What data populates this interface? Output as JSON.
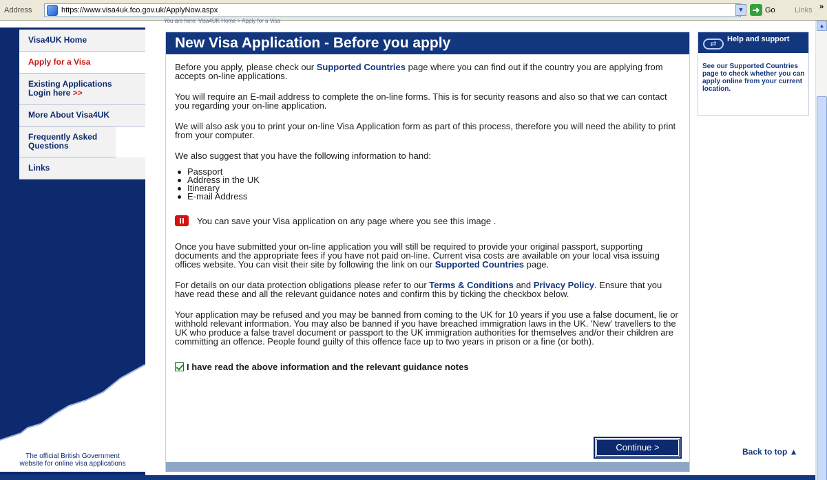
{
  "browser": {
    "address_label": "Address",
    "url": "https://www.visa4uk.fco.gov.uk/ApplyNow.aspx",
    "go_label": "Go",
    "links_label": "Links",
    "links_chevron": "»"
  },
  "breadcrumb": "You are here: Visa4UK Home > Apply for a Visa",
  "nav": {
    "items": [
      {
        "label": "Visa4UK Home"
      },
      {
        "label": "Apply for a Visa"
      },
      {
        "label": "Existing Applications",
        "sub": "Login here",
        "arrows": ">>"
      },
      {
        "label": "More About Visa4UK"
      },
      {
        "label": "Frequently Asked Questions"
      },
      {
        "label": "Links"
      }
    ],
    "official_line1": "The official British Government",
    "official_line2": "website for online visa applications"
  },
  "main": {
    "title": "New Visa Application - Before you apply",
    "p1_pre": "Before you apply, please check our ",
    "p1_link": "Supported Countries",
    "p1_post": " page where you can find out if the country you are applying from accepts on-line applications.",
    "p2": "You will require an E-mail address to complete the on-line forms.  This is for security reasons and also so that we can contact you regarding your on-line application.",
    "p3": "We will also ask you to print your on-line Visa Application form as part of this process, therefore you will need the ability to print from your computer.",
    "p4": "We also suggest that you have the following information to hand:",
    "items": [
      "Passport",
      "Address in the UK",
      "Itinerary",
      "E-mail Address"
    ],
    "save_text": "You can save your Visa application on any page where you see this image .",
    "p5_pre": "Once you have submitted your on-line application you will still be required to provide your original passport, supporting documents and the appropriate fees if you have not paid on-line. Current visa costs are available on your local visa issuing offices website. You can visit their site by following the link on our ",
    "p5_link": "Supported Countries",
    "p5_post": " page.",
    "p6_pre": "For details on our data protection obligations please refer to our ",
    "p6_link1": "Terms & Conditions",
    "p6_mid": " and ",
    "p6_link2": "Privacy Policy",
    "p6_post": ". Ensure that you have read these and all the relevant guidance notes and confirm this by ticking the checkbox below.",
    "p7": "Your application may be refused and you may be banned from coming to the UK for 10 years if you use a false document, lie or withhold relevant information. You may also be banned if you have breached immigration laws in the UK.  'New' travellers to the UK who produce a false travel document or passport to the UK immigration authorities for themselves and/or their children are committing an offence.  People found guilty of this offence face up to two years in prison or a fine (or both).",
    "confirm_label": "I have read the above information and the relevant guidance notes",
    "continue_label": "Continue >"
  },
  "help": {
    "title": "Help and support",
    "body": "See our Supported Countries page to check whether you can apply online from your current location."
  },
  "back_to_top": "Back to top ▲"
}
